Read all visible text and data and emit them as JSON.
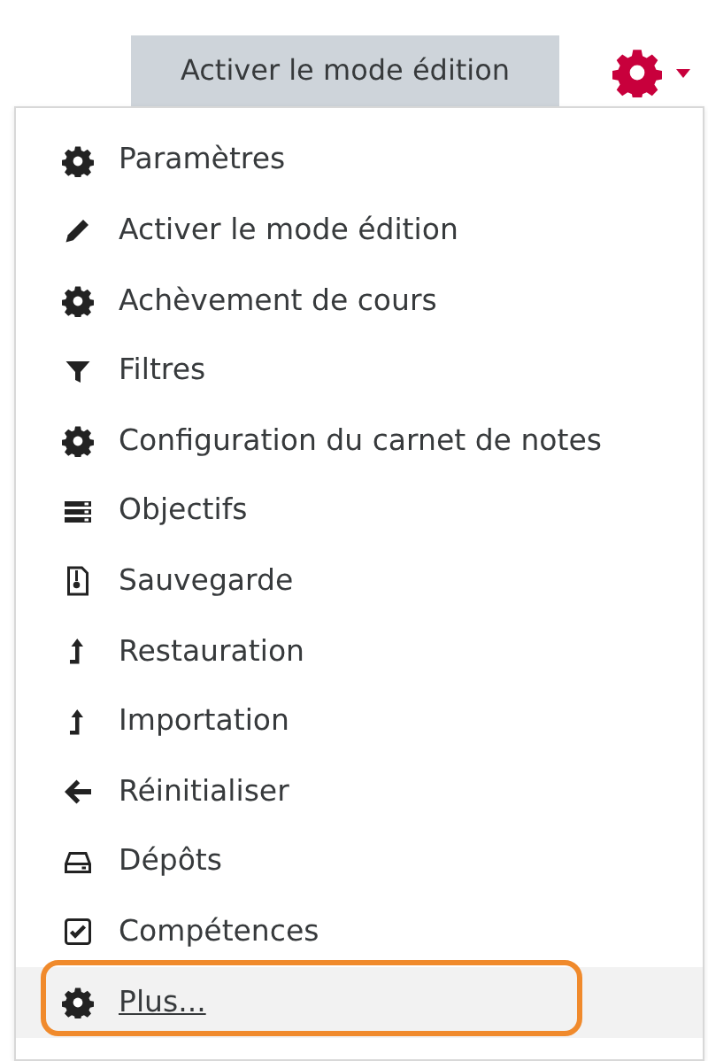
{
  "edit_button": {
    "label": "Activer le mode édition"
  },
  "settings_menu": {
    "expanded": true
  },
  "menu_items": [
    {
      "label": "Paramètres",
      "kind": "gear",
      "highlighted": false,
      "annotated": false
    },
    {
      "label": "Activer le mode édition",
      "kind": "pencil",
      "highlighted": false,
      "annotated": false
    },
    {
      "label": "Achèvement de cours",
      "kind": "gear",
      "highlighted": false,
      "annotated": false
    },
    {
      "label": "Filtres",
      "kind": "filter",
      "highlighted": false,
      "annotated": false
    },
    {
      "label": "Configuration du carnet de notes",
      "kind": "gear",
      "highlighted": false,
      "annotated": false
    },
    {
      "label": "Objectifs",
      "kind": "list",
      "highlighted": false,
      "annotated": false
    },
    {
      "label": "Sauvegarde",
      "kind": "file",
      "highlighted": false,
      "annotated": false
    },
    {
      "label": "Restauration",
      "kind": "up",
      "highlighted": false,
      "annotated": false
    },
    {
      "label": "Importation",
      "kind": "up",
      "highlighted": false,
      "annotated": false
    },
    {
      "label": "Réinitialiser",
      "kind": "left",
      "highlighted": false,
      "annotated": false
    },
    {
      "label": "Dépôts",
      "kind": "drive",
      "highlighted": false,
      "annotated": false
    },
    {
      "label": "Compétences",
      "kind": "check",
      "highlighted": false,
      "annotated": false
    },
    {
      "label": "Plus...",
      "kind": "gear",
      "highlighted": true,
      "annotated": true
    }
  ]
}
